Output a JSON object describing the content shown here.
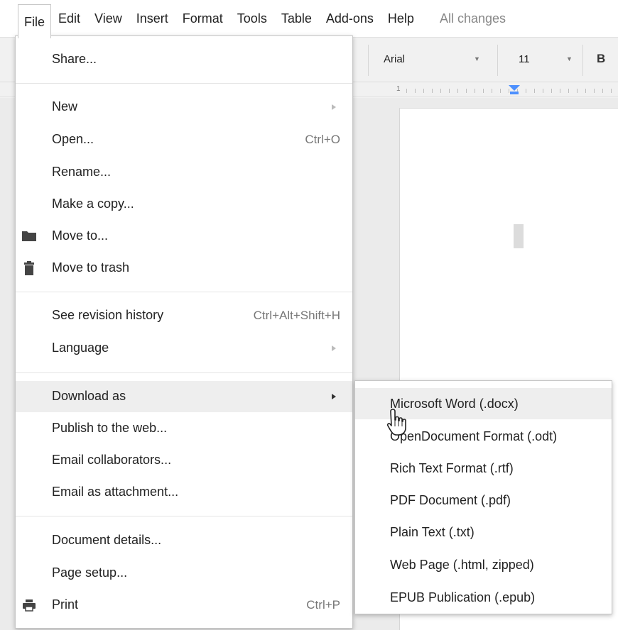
{
  "menubar": {
    "items": [
      "File",
      "Edit",
      "View",
      "Insert",
      "Format",
      "Tools",
      "Table",
      "Add-ons",
      "Help"
    ],
    "status": "All changes"
  },
  "toolbar": {
    "font": "Arial",
    "size": "11",
    "bold": "B"
  },
  "ruler": {
    "label": "1"
  },
  "file_menu": {
    "share": "Share...",
    "new": "New",
    "open": "Open...",
    "open_shortcut": "Ctrl+O",
    "rename": "Rename...",
    "make_copy": "Make a copy...",
    "move_to": "Move to...",
    "move_to_trash": "Move to trash",
    "revision_history": "See revision history",
    "revision_shortcut": "Ctrl+Alt+Shift+H",
    "language": "Language",
    "download_as": "Download as",
    "publish": "Publish to the web...",
    "email_collaborators": "Email collaborators...",
    "email_attachment": "Email as attachment...",
    "document_details": "Document details...",
    "page_setup": "Page setup...",
    "print": "Print",
    "print_shortcut": "Ctrl+P"
  },
  "download_submenu": {
    "items": [
      "Microsoft Word (.docx)",
      "OpenDocument Format (.odt)",
      "Rich Text Format (.rtf)",
      "PDF Document (.pdf)",
      "Plain Text (.txt)",
      "Web Page (.html, zipped)",
      "EPUB Publication (.epub)"
    ]
  },
  "colors": {
    "highlight": "#eeeeee",
    "accent": "#4d90fe",
    "menu_border": "#c6c6c6"
  }
}
